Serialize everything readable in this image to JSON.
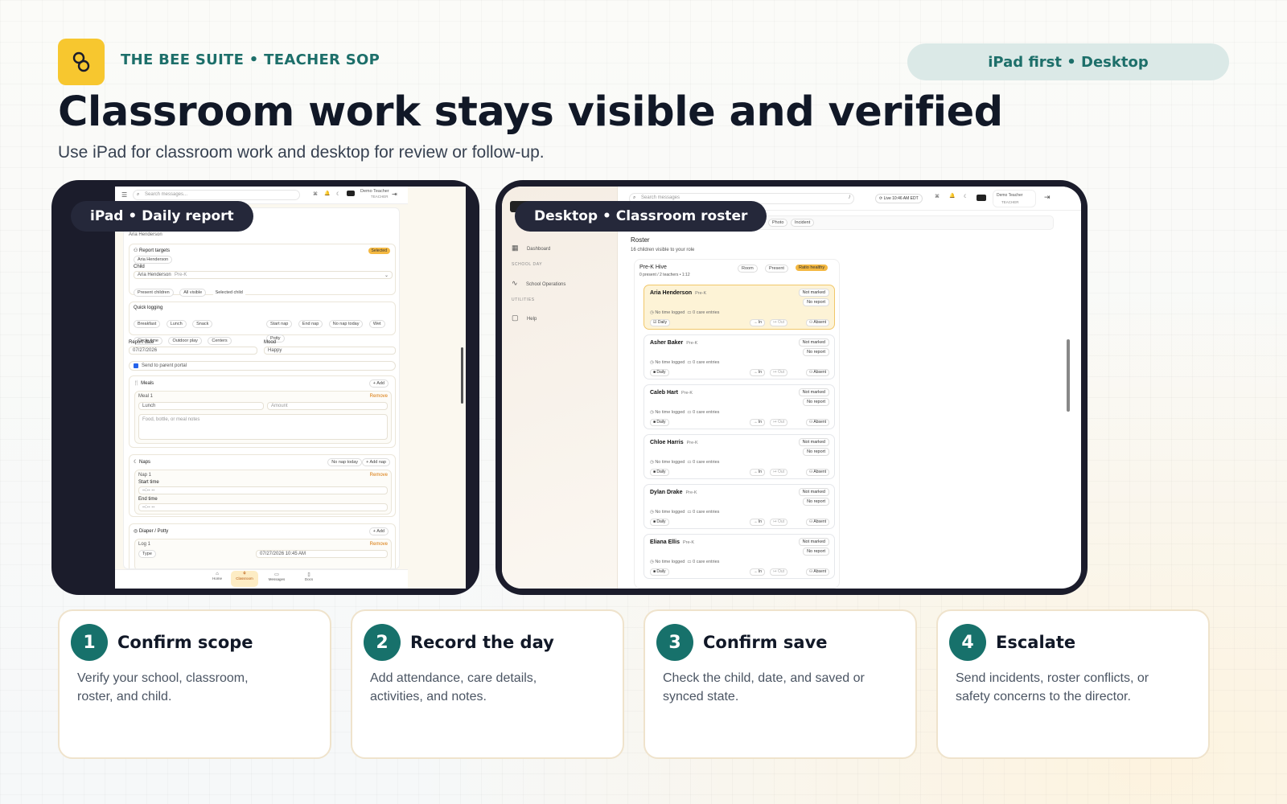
{
  "header": {
    "brand": "THE BEE SUITE • TEACHER SOP",
    "platform_pill": "iPad first • Desktop",
    "title": "Classroom work stays visible and verified",
    "subtitle": "Use iPad for classroom work and desktop for review or follow-up."
  },
  "colors": {
    "accent": "#17716b",
    "logo": "#f7c72f",
    "device": "#1b1c2b"
  },
  "ipad": {
    "label": "iPad • Daily report",
    "topbar": {
      "search_placeholder": "Search messages...",
      "user_name": "Demo Teacher",
      "user_role": "TEACHER"
    },
    "child_heading": "Aria Henderson",
    "report_targets": {
      "title": "Report targets",
      "badge": "Selected",
      "chip": "Aria Henderson",
      "child_label": "Child",
      "child_value": "Aria Henderson",
      "child_grade": "Pre-K",
      "actions": [
        "Present children",
        "All visible",
        "Selected child"
      ]
    },
    "quick_logging": {
      "title": "Quick logging",
      "chips_left": [
        "Breakfast",
        "Lunch",
        "Snack",
        "Circle time",
        "Outdoor play",
        "Centers"
      ],
      "chips_right": [
        "Start nap",
        "End nap",
        "No nap today",
        "Wet",
        "Potty"
      ]
    },
    "report_date_label": "Report date",
    "report_date": "07/27/2026",
    "mood_label": "Mood",
    "mood": "Happy",
    "send_portal": "Send to parent portal",
    "meals": {
      "title": "Meals",
      "add": "+ Add",
      "meal_label": "Meal 1",
      "remove": "Remove",
      "type": "Lunch",
      "amount_placeholder": "Amount",
      "notes_placeholder": "Food, bottle, or meal notes"
    },
    "naps": {
      "title": "Naps",
      "no_nap": "No nap today",
      "add": "+ Add nap",
      "nap_label": "Nap 1",
      "remove": "Remove",
      "start_label": "Start time",
      "end_label": "End time",
      "time_placeholder": "--:-- --"
    },
    "diaper": {
      "title": "Diaper / Potty",
      "add": "+ Add",
      "log_label": "Log 1",
      "remove": "Remove",
      "type_label": "Type",
      "datetime": "07/27/2026 10:45 AM"
    },
    "bottom_nav": [
      "Home",
      "Classroom",
      "Messages",
      "Docs"
    ]
  },
  "desktop": {
    "label": "Desktop • Classroom roster",
    "topbar": {
      "search_placeholder": "Search messages",
      "live": "Live 10:46 AM EDT",
      "user_name": "Demo Teacher",
      "user_role": "TEACHER"
    },
    "sidebar": {
      "dashboard": "Dashboard",
      "section_school_day": "SCHOOL DAY",
      "school_operations": "School Operations",
      "section_utilities": "UTILITIES",
      "help": "Help"
    },
    "tabs": [
      "Photo",
      "Incident"
    ],
    "roster": {
      "title": "Roster",
      "subtitle": "16 children visible to your role",
      "room_name": "Pre-K Hive",
      "room_meta": "0 present / 2 teachers • 1:12",
      "room_chips": [
        "Room",
        "Present"
      ],
      "room_status": "Ratio healthy",
      "children": [
        {
          "name": "Aria Henderson",
          "grade": "Pre-K",
          "status": "Not marked",
          "report": "No report",
          "time": "No time logged",
          "care": "0 care entries",
          "daily": "Daily",
          "in": "In",
          "out": "Out",
          "absent": "Absent"
        },
        {
          "name": "Asher Baker",
          "grade": "Pre-K",
          "status": "Not marked",
          "report": "No report",
          "time": "No time logged",
          "care": "0 care entries",
          "daily": "Daily",
          "in": "In",
          "out": "Out",
          "absent": "Absent"
        },
        {
          "name": "Caleb Hart",
          "grade": "Pre-K",
          "status": "Not marked",
          "report": "No report",
          "time": "No time logged",
          "care": "0 care entries",
          "daily": "Daily",
          "in": "In",
          "out": "Out",
          "absent": "Absent"
        },
        {
          "name": "Chloe Harris",
          "grade": "Pre-K",
          "status": "Not marked",
          "report": "No report",
          "time": "No time logged",
          "care": "0 care entries",
          "daily": "Daily",
          "in": "In",
          "out": "Out",
          "absent": "Absent"
        },
        {
          "name": "Dylan Drake",
          "grade": "Pre-K",
          "status": "Not marked",
          "report": "No report",
          "time": "No time logged",
          "care": "0 care entries",
          "daily": "Daily",
          "in": "In",
          "out": "Out",
          "absent": "Absent"
        },
        {
          "name": "Eliana Ellis",
          "grade": "Pre-K",
          "status": "Not marked",
          "report": "No report",
          "time": "No time logged",
          "care": "0 care entries",
          "daily": "Daily",
          "in": "In",
          "out": "Out",
          "absent": "Absent"
        }
      ]
    }
  },
  "steps": [
    {
      "num": "1",
      "title": "Confirm scope",
      "body": "Verify your school, classroom, roster, and child."
    },
    {
      "num": "2",
      "title": "Record the day",
      "body": "Add attendance, care details, activities, and notes."
    },
    {
      "num": "3",
      "title": "Confirm save",
      "body": "Check the child, date, and saved or synced state."
    },
    {
      "num": "4",
      "title": "Escalate",
      "body": "Send incidents, roster conflicts, or safety concerns to the director."
    }
  ]
}
